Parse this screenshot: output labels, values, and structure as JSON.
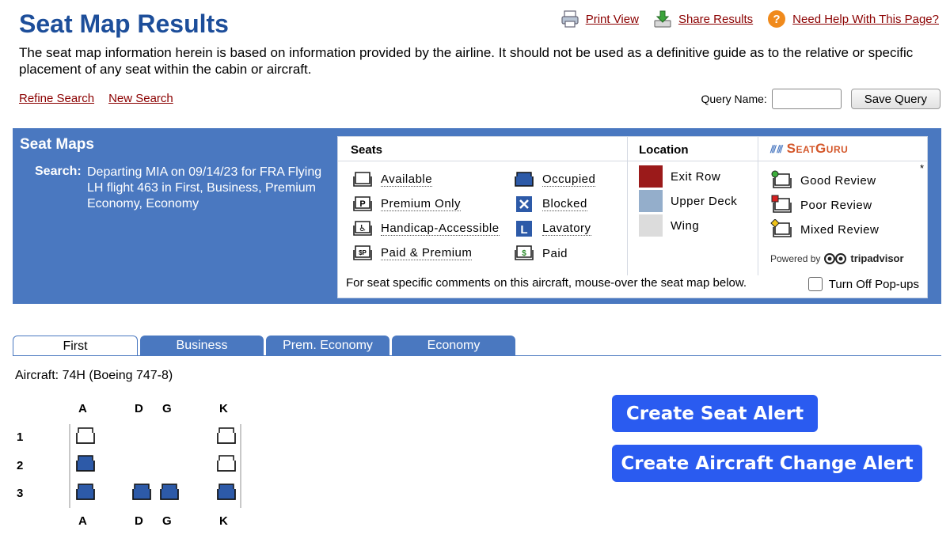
{
  "header": {
    "title": "Seat Map Results",
    "links": [
      {
        "label": "Print View",
        "icon": "printer-icon"
      },
      {
        "label": "Share Results",
        "icon": "download-share-icon"
      },
      {
        "label": "Need Help With This Page?",
        "icon": "help-icon"
      }
    ]
  },
  "disclaimer": "The seat map information herein is based on information provided by the airline. It should not be used as a definitive guide as to the relative or specific placement of any seat within the cabin or aircraft.",
  "nav": {
    "refine_search": "Refine Search",
    "new_search": "New Search"
  },
  "query": {
    "label": "Query Name:",
    "value": "",
    "placeholder": "",
    "save_label": "Save Query"
  },
  "panel": {
    "title": "Seat Maps",
    "search_label": "Search:",
    "search_value": "Departing MIA on 09/14/23 for FRA Flying LH flight 463 in First, Business, Premium Economy, Economy"
  },
  "legend": {
    "seats_heading": "Seats",
    "location_heading": "Location",
    "seatguru_logo": "SeatGuru",
    "seats": [
      {
        "label": "Available",
        "icon": "available-seat-icon"
      },
      {
        "label": "Premium Only",
        "icon": "premium-seat-icon"
      },
      {
        "label": "Handicap-Accessible",
        "icon": "handicap-seat-icon"
      },
      {
        "label": "Paid & Premium",
        "icon": "paid-premium-seat-icon"
      },
      {
        "label": "Occupied",
        "icon": "occupied-seat-icon"
      },
      {
        "label": "Blocked",
        "icon": "blocked-seat-icon"
      },
      {
        "label": "Lavatory",
        "icon": "lavatory-icon"
      },
      {
        "label": "Paid",
        "icon": "paid-seat-icon"
      }
    ],
    "locations": [
      {
        "label": "Exit Row",
        "color": "#9b1a1a"
      },
      {
        "label": "Upper Deck",
        "color": "#94aecb"
      },
      {
        "label": "Wing",
        "color": "#dcdcdc"
      }
    ],
    "reviews": [
      {
        "label": "Good Review",
        "color": "#3cae3c"
      },
      {
        "label": "Poor Review",
        "color": "#d62020"
      },
      {
        "label": "Mixed Review",
        "color": "#f0c419"
      }
    ],
    "asterisk": "*",
    "powered_by": "Powered by",
    "tripadvisor": "tripadvisor",
    "footer_text": "For seat specific comments on this aircraft, mouse-over the seat map below.",
    "popups_label": "Turn Off Pop-ups",
    "popups_checked": false
  },
  "tabs": [
    {
      "label": "First",
      "active": true
    },
    {
      "label": "Business",
      "active": false
    },
    {
      "label": "Prem. Economy",
      "active": false
    },
    {
      "label": "Economy",
      "active": false
    }
  ],
  "aircraft": "Aircraft: 74H (Boeing 747-8)",
  "seatmap": {
    "columns": [
      "A",
      "D",
      "G",
      "K"
    ],
    "rows": [
      {
        "row": "1",
        "seats": {
          "A": "available",
          "K": "available"
        }
      },
      {
        "row": "2",
        "seats": {
          "A": "occupied",
          "K": "available"
        }
      },
      {
        "row": "3",
        "seats": {
          "A": "occupied",
          "D": "occupied",
          "G": "occupied",
          "K": "occupied"
        }
      }
    ]
  },
  "alerts": {
    "seat_alert": "Create Seat Alert",
    "aircraft_change_alert": "Create Aircraft Change Alert"
  },
  "colors": {
    "title_blue": "#1d4e9a",
    "panel_blue": "#4a78c0",
    "link_red": "#8b0000",
    "alert_blue": "#2a5bf0",
    "occupied_seat": "#2d5aa8"
  }
}
